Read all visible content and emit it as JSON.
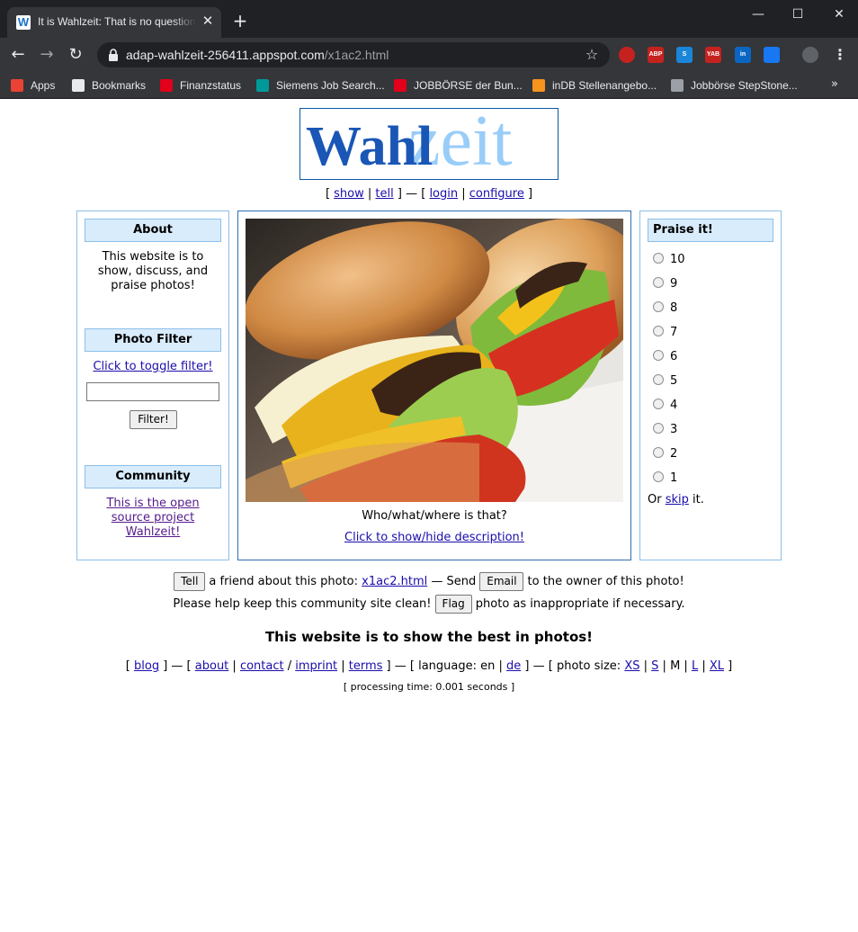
{
  "browser": {
    "tab_title": "It is Wahlzeit: That is no question!",
    "tab_favicon": "W",
    "url_host": "adap-wahlzeit-256411.appspot.com",
    "url_path": "/x1ac2.html",
    "bookmarks": [
      {
        "label": "Apps",
        "icon": "apps-grid-icon",
        "color": "#ea4335"
      },
      {
        "label": "Bookmarks",
        "icon": "star-icon",
        "color": "#e8eaed"
      },
      {
        "label": "Finanzstatus",
        "icon": "sparkasse-icon",
        "color": "#e2001a"
      },
      {
        "label": "Siemens Job Search...",
        "icon": "siemens-icon",
        "color": "#009999"
      },
      {
        "label": "JOBBÖRSE der Bun...",
        "icon": "arbeitsagentur-icon",
        "color": "#e2001a"
      },
      {
        "label": "inDB Stellenangebo...",
        "icon": "indb-icon",
        "color": "#f7941d"
      },
      {
        "label": "Jobbörse StepStone...",
        "icon": "stepstone-icon",
        "color": "#9aa0a6"
      }
    ],
    "extensions": [
      {
        "name": "blocker-extension-icon",
        "label": "",
        "color": "#c5221f"
      },
      {
        "name": "adblock-plus-icon",
        "label": "ABP",
        "color": "#c5221f"
      },
      {
        "name": "skype-extension-icon",
        "label": "S",
        "color": "#1a86d8"
      },
      {
        "name": "yab-extension-icon",
        "label": "YAB",
        "color": "#c5221f"
      },
      {
        "name": "linkedin-extension-icon",
        "label": "in",
        "color": "#0a66c2"
      },
      {
        "name": "messenger-extension-icon",
        "label": "",
        "color": "#1877f2"
      },
      {
        "name": "profile-avatar-icon",
        "label": "",
        "color": "#5f6368"
      }
    ]
  },
  "page": {
    "logo": {
      "part1": "Wahl",
      "part2": "zeit"
    },
    "topnav": {
      "show": "show",
      "tell": "tell",
      "login": "login",
      "configure": "configure"
    },
    "about": {
      "heading": "About",
      "text_lines": [
        "This website is to",
        "show, discuss, and",
        "praise photos!"
      ]
    },
    "filter": {
      "heading": "Photo Filter",
      "toggle_link": "Click to toggle filter!",
      "input_value": "",
      "button": "Filter!"
    },
    "community": {
      "heading": "Community",
      "link_lines": [
        "This is the open",
        "source project",
        "Wahlzeit!"
      ]
    },
    "photo": {
      "caption": "Who/what/where is that?",
      "toggle_description": "Click to show/hide description!"
    },
    "praise": {
      "heading": "Praise it!",
      "options": [
        "10",
        "9",
        "8",
        "7",
        "6",
        "5",
        "4",
        "3",
        "2",
        "1"
      ],
      "or_text": "Or",
      "skip_link": "skip",
      "it_text": "it."
    },
    "actions": {
      "tell_button": "Tell",
      "tell_text": "a friend about this photo:",
      "photo_link": "x1ac2.html",
      "send_text": "— Send",
      "email_button": "Email",
      "email_text": "to the owner of this photo!",
      "flag_prefix": "Please help keep this community site clean!",
      "flag_button": "Flag",
      "flag_suffix": "photo as inappropriate if necessary."
    },
    "tagline": "This website is to show the best in photos!",
    "footer": {
      "blog": "blog",
      "about": "about",
      "contact": "contact",
      "imprint": "imprint",
      "terms": "terms",
      "language_label": "language: en",
      "language_de": "de",
      "photo_size_label": "photo size:",
      "sizes": [
        "XS",
        "S",
        "M",
        "L",
        "XL"
      ],
      "current_size": "M",
      "processing": "[ processing time: 0.001 seconds ]"
    }
  }
}
